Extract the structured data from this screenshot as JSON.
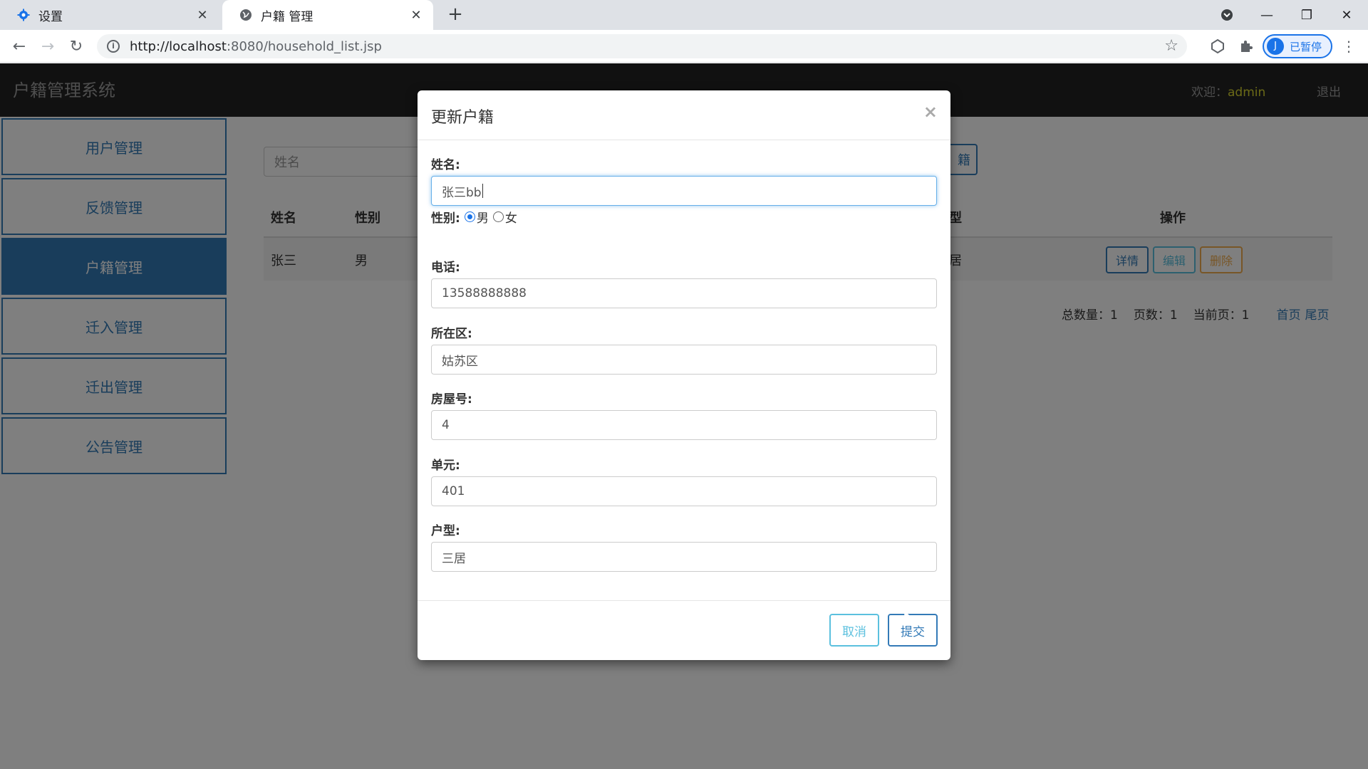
{
  "browser": {
    "tabs": [
      {
        "title": "设置",
        "icon": "gear-icon"
      },
      {
        "title": "户籍 管理",
        "icon": "globe-icon"
      }
    ],
    "url_host": "http://localhost",
    "url_rest": ":8080/household_list.jsp",
    "profile_initial": "J",
    "profile_label": "已暂停"
  },
  "app": {
    "brand": "户籍管理系统",
    "welcome_label": "欢迎：",
    "username": "admin",
    "logout": "退出",
    "accent_color": "#337ab7"
  },
  "sidebar": {
    "items": [
      {
        "label": "用户管理"
      },
      {
        "label": "反馈管理"
      },
      {
        "label": "户籍管理",
        "active": true
      },
      {
        "label": "迁入管理"
      },
      {
        "label": "迁出管理"
      },
      {
        "label": "公告管理"
      }
    ]
  },
  "search": {
    "placeholder": "姓名",
    "button_partial": "籍"
  },
  "table": {
    "headers": [
      "姓名",
      "性别",
      "型",
      "操作"
    ],
    "rows": [
      {
        "name": "张三",
        "gender": "男",
        "type_partial": "居"
      }
    ],
    "actions": {
      "detail": "详情",
      "edit": "编辑",
      "delete": "删除"
    }
  },
  "pager": {
    "total": "总数量：1",
    "pages": "页数：1",
    "current": "当前页：1",
    "first": "首页",
    "last": "尾页"
  },
  "modal": {
    "title": "更新户籍",
    "close": "×",
    "fields": {
      "name": {
        "label": "姓名:",
        "value": "张三bb"
      },
      "gender": {
        "label": "性别:",
        "options": [
          "男",
          "女"
        ],
        "selected": "男"
      },
      "phone": {
        "label": "电话:",
        "value": "13588888888"
      },
      "district": {
        "label": "所在区:",
        "value": "姑苏区"
      },
      "house_no": {
        "label": "房屋号:",
        "value": "4"
      },
      "unit": {
        "label": "单元:",
        "value": "401"
      },
      "house_type": {
        "label": "户型:",
        "value": "三居"
      }
    },
    "cancel": "取消",
    "submit": "提交"
  }
}
